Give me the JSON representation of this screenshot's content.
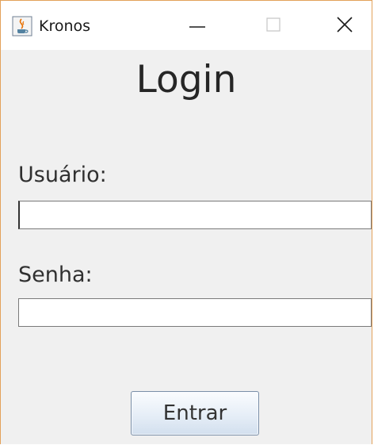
{
  "window": {
    "title": "Kronos",
    "icon": "java-coffee-cup-icon"
  },
  "controls": {
    "minimize_icon": "minimize-icon",
    "maximize_icon": "maximize-icon",
    "close_icon": "close-icon"
  },
  "form": {
    "heading": "Login",
    "username_label": "Usuário:",
    "username_value": "",
    "password_label": "Senha:",
    "password_value": "",
    "submit_label": "Entrar"
  },
  "colors": {
    "window_border": "#e3a25a",
    "background": "#f0f0f0",
    "titlebar": "#ffffff"
  }
}
